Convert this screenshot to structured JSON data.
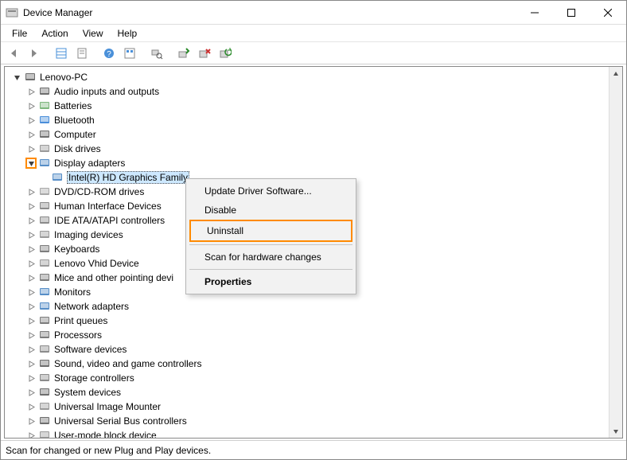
{
  "window": {
    "title": "Device Manager"
  },
  "menu": {
    "items": [
      "File",
      "Action",
      "View",
      "Help"
    ]
  },
  "toolbar": {
    "buttons": [
      {
        "name": "back",
        "glyph": "arrow-left"
      },
      {
        "name": "forward",
        "glyph": "arrow-right"
      },
      {
        "name": "sep"
      },
      {
        "name": "show-hidden",
        "glyph": "grid"
      },
      {
        "name": "properties",
        "glyph": "page"
      },
      {
        "name": "sep"
      },
      {
        "name": "help",
        "glyph": "help"
      },
      {
        "name": "view-options",
        "glyph": "grid-small"
      },
      {
        "name": "sep"
      },
      {
        "name": "find",
        "glyph": "find"
      },
      {
        "name": "sep"
      },
      {
        "name": "update-driver",
        "glyph": "update"
      },
      {
        "name": "uninstall",
        "glyph": "remove"
      },
      {
        "name": "scan-hardware",
        "glyph": "scan"
      }
    ]
  },
  "tree": {
    "root": "Lenovo-PC",
    "items": [
      {
        "label": "Audio inputs and outputs",
        "icon": "audio"
      },
      {
        "label": "Batteries",
        "icon": "battery"
      },
      {
        "label": "Bluetooth",
        "icon": "bluetooth"
      },
      {
        "label": "Computer",
        "icon": "computer"
      },
      {
        "label": "Disk drives",
        "icon": "disk"
      },
      {
        "label": "Display adapters",
        "icon": "display",
        "expanded": true,
        "highlight": true,
        "children": [
          {
            "label": "Intel(R) HD Graphics Family",
            "icon": "display",
            "selected": true
          }
        ]
      },
      {
        "label": "DVD/CD-ROM drives",
        "icon": "dvd"
      },
      {
        "label": "Human Interface Devices",
        "icon": "hid"
      },
      {
        "label": "IDE ATA/ATAPI controllers",
        "icon": "ide"
      },
      {
        "label": "Imaging devices",
        "icon": "imaging"
      },
      {
        "label": "Keyboards",
        "icon": "keyboard"
      },
      {
        "label": "Lenovo Vhid Device",
        "icon": "generic"
      },
      {
        "label": "Mice and other pointing devi",
        "icon": "mouse"
      },
      {
        "label": "Monitors",
        "icon": "monitor"
      },
      {
        "label": "Network adapters",
        "icon": "network"
      },
      {
        "label": "Print queues",
        "icon": "printer"
      },
      {
        "label": "Processors",
        "icon": "cpu"
      },
      {
        "label": "Software devices",
        "icon": "software"
      },
      {
        "label": "Sound, video and game controllers",
        "icon": "sound"
      },
      {
        "label": "Storage controllers",
        "icon": "storage"
      },
      {
        "label": "System devices",
        "icon": "system"
      },
      {
        "label": "Universal Image Mounter",
        "icon": "generic"
      },
      {
        "label": "Universal Serial Bus controllers",
        "icon": "usb"
      },
      {
        "label": "User-mode block device",
        "icon": "generic"
      }
    ]
  },
  "context_menu": {
    "items": [
      {
        "label": "Update Driver Software...",
        "kind": "item"
      },
      {
        "label": "Disable",
        "kind": "item"
      },
      {
        "label": "Uninstall",
        "kind": "item",
        "highlight": true
      },
      {
        "kind": "sep"
      },
      {
        "label": "Scan for hardware changes",
        "kind": "item"
      },
      {
        "kind": "sep"
      },
      {
        "label": "Properties",
        "kind": "item",
        "bold": true
      }
    ]
  },
  "status": {
    "text": "Scan for changed or new Plug and Play devices."
  },
  "colors": {
    "highlight": "#ff8a00",
    "selection": "#cde8ff"
  }
}
